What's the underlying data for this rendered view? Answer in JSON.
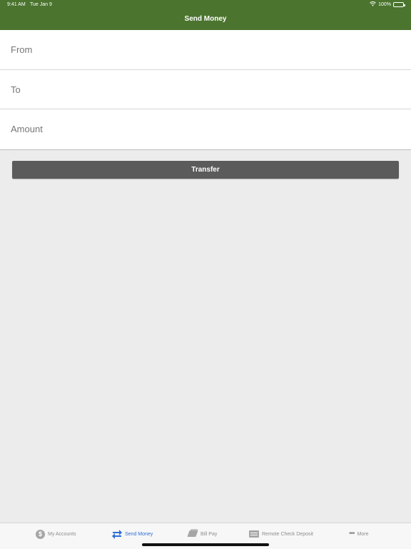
{
  "status_bar": {
    "time": "9:41 AM",
    "date": "Tue Jan 9",
    "battery": "100%"
  },
  "header": {
    "title": "Send Money"
  },
  "form": {
    "fields": [
      {
        "label": "From"
      },
      {
        "label": "To"
      },
      {
        "label": "Amount"
      }
    ],
    "button_label": "Transfer"
  },
  "tabs": [
    {
      "label": "My Accounts",
      "icon": "dollar-icon"
    },
    {
      "label": "Send Money",
      "icon": "transfer-icon",
      "active": true
    },
    {
      "label": "Bill Pay",
      "icon": "bill-icon"
    },
    {
      "label": "Remote Check Deposit",
      "icon": "check-icon"
    },
    {
      "label": "More",
      "icon": "more-icon"
    }
  ],
  "colors": {
    "header": "#4b742f",
    "active_tab": "#2f6ed6",
    "button": "#5b5b5b",
    "background": "#ececec"
  }
}
